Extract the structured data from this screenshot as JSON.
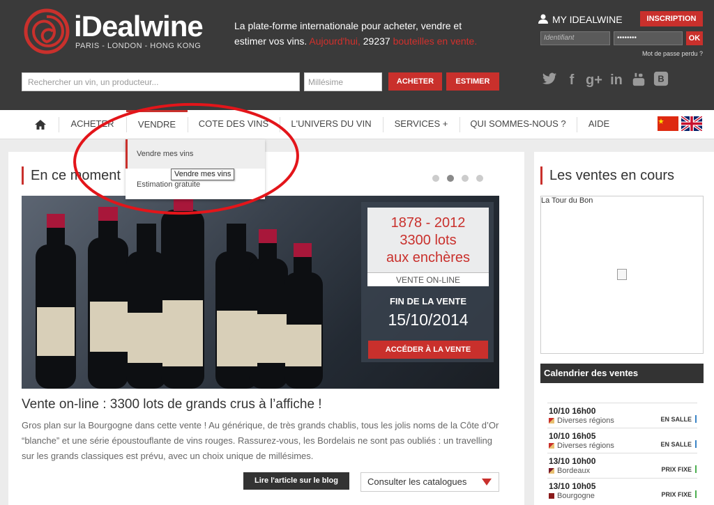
{
  "header": {
    "logo_name": "iDealwine",
    "logo_cities": "PARIS - LONDON - HONG KONG",
    "tagline_main": "La plate-forme internationale pour acheter, vendre et estimer vos vins.",
    "tagline_today": "Aujourd'hui,",
    "tagline_count": "29237",
    "tagline_end": "bouteilles en vente.",
    "my_account": "MY IDEALWINE",
    "signup_label": "INSCRIPTION",
    "login_placeholder": "Identifiant",
    "password_value": "••••••••",
    "ok_label": "OK",
    "password_lost": "Mot de passe perdu ?",
    "search_placeholder": "Rechercher un vin, un producteur...",
    "vintage_placeholder": "Millésime",
    "buy_label": "ACHETER",
    "estimate_label": "ESTIMER",
    "social": [
      "twitter-icon",
      "facebook-icon",
      "googleplus-icon",
      "linkedin-icon",
      "youtube-icon",
      "blogger-icon"
    ]
  },
  "nav": {
    "items": [
      "ACHETER",
      "VENDRE",
      "COTE DES VINS",
      "L'UNIVERS DU VIN",
      "SERVICES +",
      "QUI SOMMES-NOUS ?",
      "AIDE"
    ],
    "active": "VENDRE"
  },
  "dropdown": {
    "items": [
      "Vendre mes vins",
      "Estimation gratuite"
    ],
    "tooltip": "Vendre mes vins"
  },
  "main": {
    "section_title": "En ce moment",
    "slider_dots": 4,
    "slider_active": 2,
    "hero": {
      "years": "1878 - 2012",
      "lots": "3300 lots",
      "auction": "aux enchères",
      "online": "VENTE ON-LINE",
      "end_label": "FIN DE LA VENTE",
      "end_date": "15/10/2014",
      "cta": "ACCÉDER À LA VENTE"
    },
    "article_title": "Vente on-line : 3300 lots de grands crus à l’affiche !",
    "article_text": "Gros plan sur la Bourgogne dans cette vente ! Au générique, de très grands chablis, tous les jolis noms de la Côte d’Or “blanche” et une série époustouflante de vins rouges. Rassurez-vous, les Bordelais ne sont pas oubliés : un travelling sur les grands classiques est prévu, avec un choix unique de millésimes.",
    "blog_btn": "Lire l'article sur le blog",
    "catalog_btn": "Consulter les catalogues"
  },
  "sidebar": {
    "title": "Les ventes en cours",
    "sale_caption": "La Tour du Bon",
    "calendar_title": "Calendrier des ventes",
    "sales": [
      {
        "date": "10/10 16h00",
        "region": "Diverses régions",
        "type": "EN SALLE",
        "color": "#3a84c6"
      },
      {
        "date": "10/10 16h05",
        "region": "Diverses régions",
        "type": "EN SALLE",
        "color": "#3a84c6"
      },
      {
        "date": "13/10 10h00",
        "region": "Bordeaux",
        "type": "PRIX FIXE",
        "color": "#4caf50"
      },
      {
        "date": "13/10 10h05",
        "region": "Bourgogne",
        "type": "PRIX FIXE",
        "color": "#4caf50"
      }
    ]
  },
  "colors": {
    "brand_red": "#c9302c",
    "header_bg": "#3a3a3a"
  }
}
